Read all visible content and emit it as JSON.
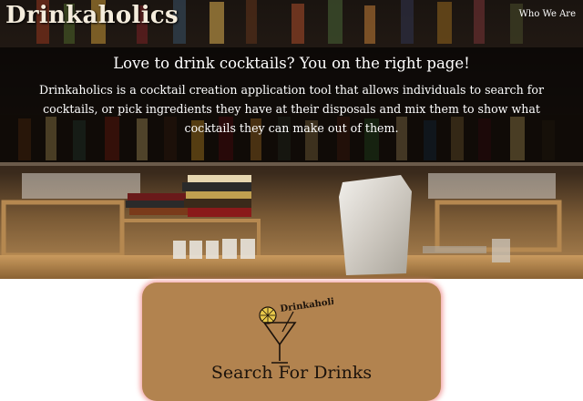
{
  "header": {
    "logo_text": "Drinkaholics",
    "nav": [
      {
        "label": "Who We Are"
      }
    ]
  },
  "hero": {
    "headline": "Love to drink cocktails? You on the right page!",
    "intro": "Drinkaholics is a cocktail creation application tool that allows individuals to search for cocktails, or pick ingredients they have at their disposals and mix them to show what cocktails they can make out of them."
  },
  "search_card": {
    "logo_text": "Drinkaholics",
    "title": "Search For Drinks"
  },
  "colors": {
    "card_background": "#b2834f",
    "card_glow": "#f2a0a0",
    "hero_text": "#ffffff",
    "logo_text": "#f4ecdc"
  }
}
